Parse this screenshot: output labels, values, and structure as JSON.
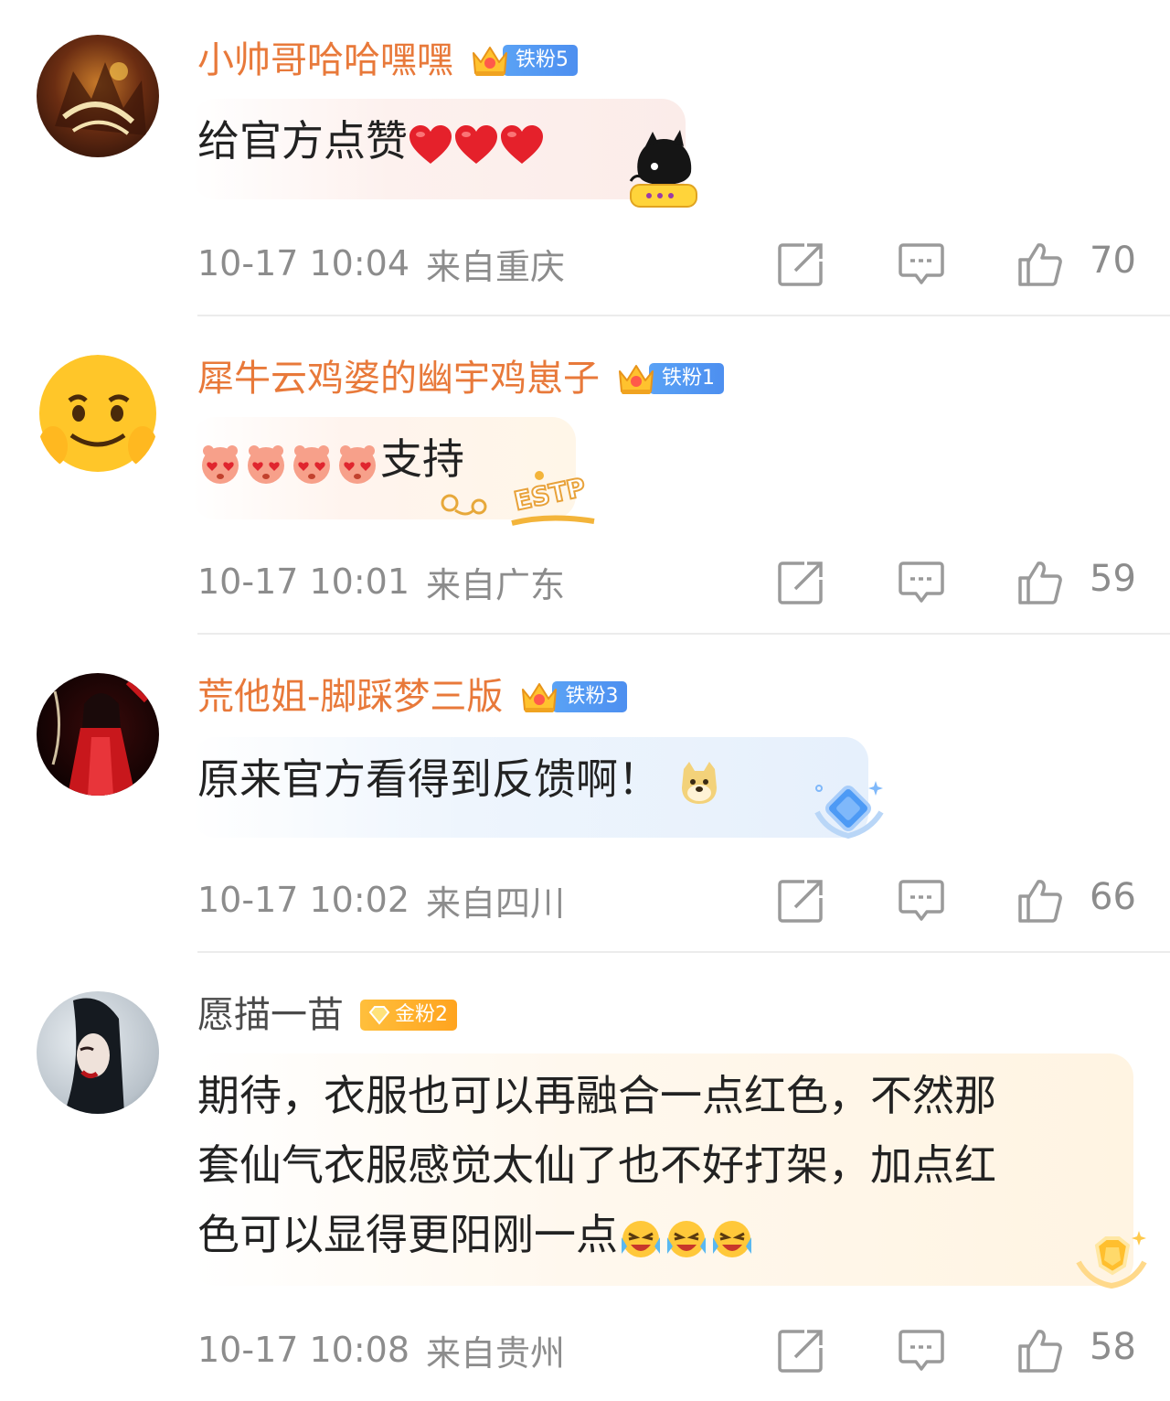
{
  "comments": [
    {
      "username": "小帅哥哈哈嘿嘿",
      "username_color": "#e8793a",
      "badge": "铁粉5",
      "badge_kind": "iron",
      "text": "给官方点赞",
      "emojis": [
        "heart-icon",
        "heart-icon",
        "heart-icon"
      ],
      "time": "10-17 10:04",
      "location": "来自重庆",
      "likes": "70"
    },
    {
      "username": "犀牛云鸡婆的幽宇鸡崽子",
      "username_color": "#e8793a",
      "badge": "铁粉1",
      "badge_kind": "iron",
      "text": "支持",
      "emojis": [
        "heart-eyes-icon",
        "heart-eyes-icon",
        "heart-eyes-icon",
        "heart-eyes-icon"
      ],
      "decor_text": "ESTP",
      "time": "10-17 10:01",
      "location": "来自广东",
      "likes": "59"
    },
    {
      "username": "荒他姐-脚踩梦三版",
      "username_color": "#e8793a",
      "badge": "铁粉3",
      "badge_kind": "iron",
      "text": "原来官方看得到反馈啊！",
      "emojis": [
        "doge-icon"
      ],
      "time": "10-17 10:02",
      "location": "来自四川",
      "likes": "66"
    },
    {
      "username": "愿描一苗",
      "username_color": "#4a4a4a",
      "badge": "金粉2",
      "badge_kind": "gold",
      "text_lines": [
        "期待，衣服也可以再融合一点红色，不然那",
        "套仙气衣服感觉太仙了也不好打架，加点红",
        "色可以显得更阳刚一点"
      ],
      "emojis": [
        "laugh-cry-icon",
        "laugh-cry-icon",
        "laugh-cry-icon"
      ],
      "time": "10-17 10:08",
      "location": "来自贵州",
      "likes": "58"
    }
  ],
  "icons": {
    "share": "share-icon",
    "reply": "comment-icon",
    "like": "thumbs-up-icon"
  },
  "colors": {
    "iron_badge": "#4d8ff0",
    "gold_badge": "#ffa41f",
    "meta_text": "#8c8c8c"
  }
}
